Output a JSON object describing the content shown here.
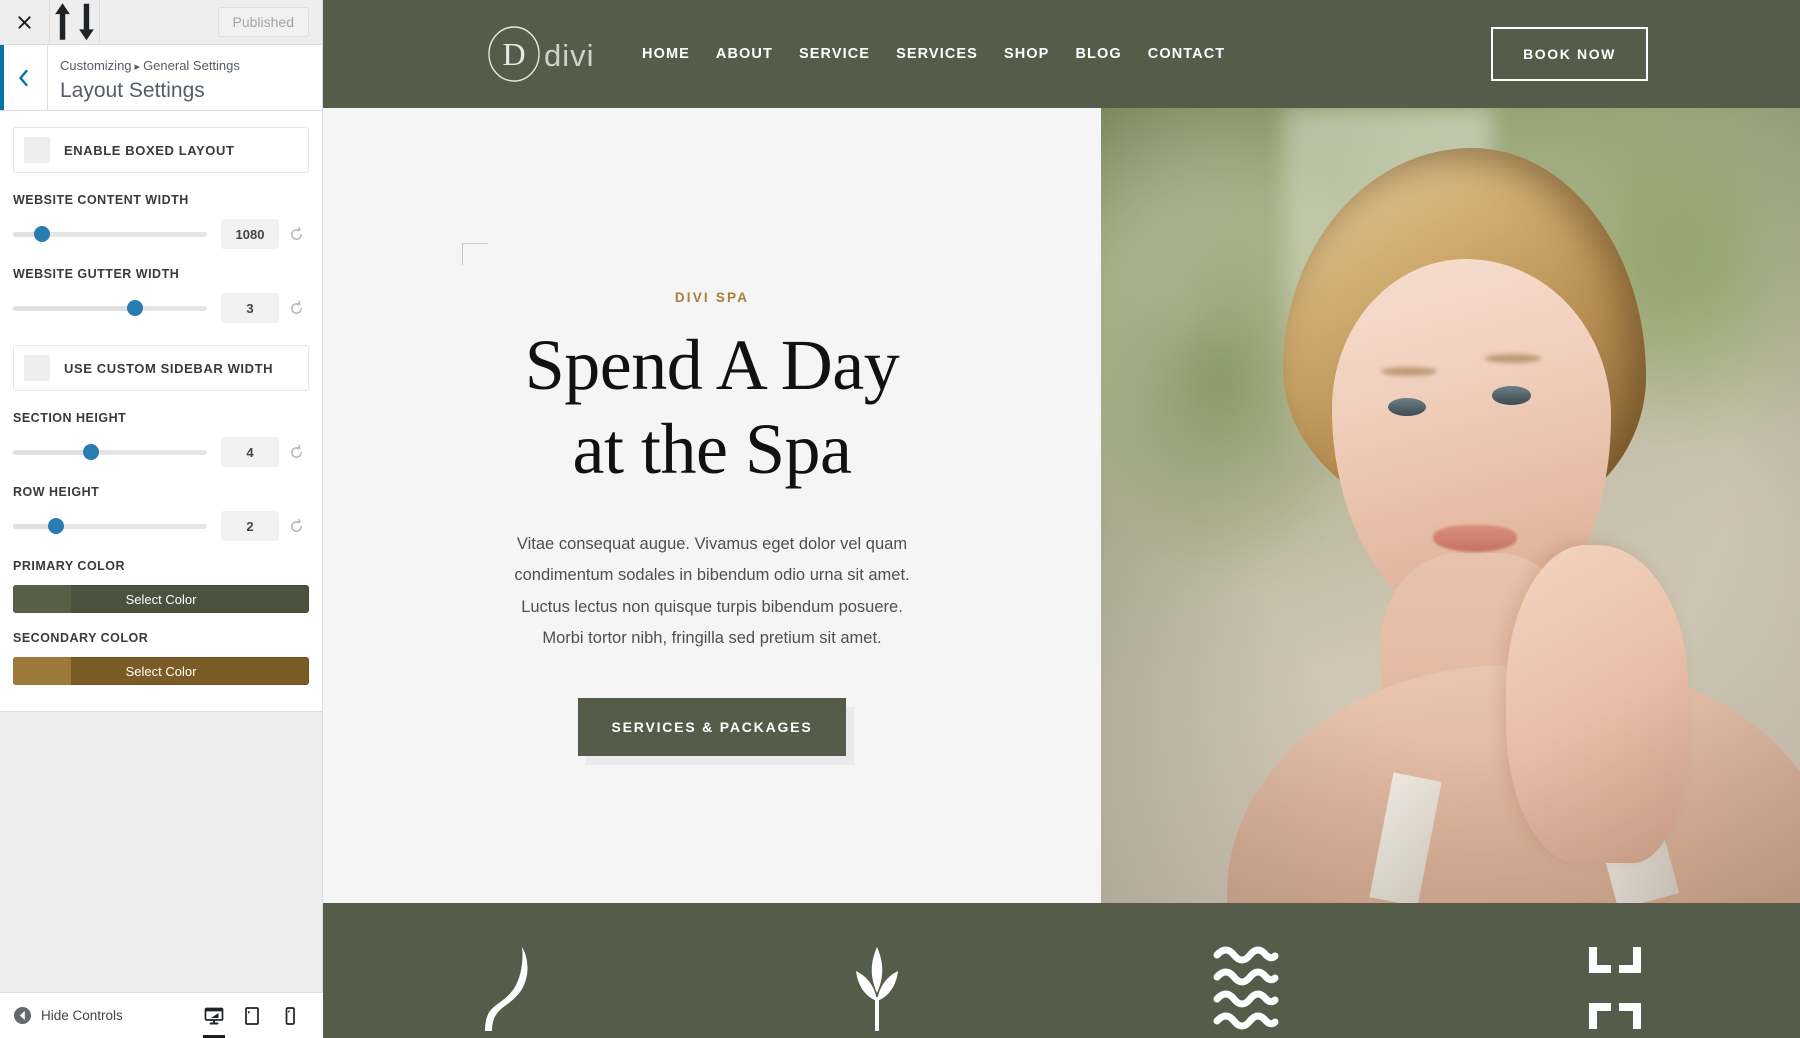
{
  "customizer": {
    "topbar": {
      "close_icon": "close-icon",
      "devices_icon": "sort-arrows-icon",
      "publish_label": "Published"
    },
    "header": {
      "back_icon": "chevron-left-icon",
      "breadcrumb_root": "Customizing",
      "breadcrumb_separator": "▸",
      "breadcrumb_parent": "General Settings",
      "title": "Layout Settings"
    },
    "controls": [
      {
        "type": "toggle",
        "name": "enable-boxed-layout",
        "label": "ENABLE BOXED LAYOUT",
        "checked": false
      },
      {
        "type": "slider",
        "name": "website-content-width",
        "label": "WEBSITE CONTENT WIDTH",
        "value": "1080",
        "percent": 15
      },
      {
        "type": "slider",
        "name": "website-gutter-width",
        "label": "WEBSITE GUTTER WIDTH",
        "value": "3",
        "percent": 63
      },
      {
        "type": "toggle",
        "name": "use-custom-sidebar-width",
        "label": "USE CUSTOM SIDEBAR WIDTH",
        "checked": false
      },
      {
        "type": "slider",
        "name": "section-height",
        "label": "SECTION HEIGHT",
        "value": "4",
        "percent": 40
      },
      {
        "type": "slider",
        "name": "row-height",
        "label": "ROW HEIGHT",
        "value": "2",
        "percent": 22
      },
      {
        "type": "color",
        "name": "primary-color",
        "label": "PRIMARY COLOR",
        "button_label": "Select Color",
        "color": "#4b5340",
        "swatch": "#5b6149"
      },
      {
        "type": "color",
        "name": "secondary-color",
        "label": "SECONDARY COLOR",
        "button_label": "Select Color",
        "color": "#7c5c26",
        "swatch": "#a5813c"
      }
    ],
    "footer": {
      "hide_controls_label": "Hide Controls",
      "hide_controls_icon": "collapse-left-icon",
      "devices": [
        {
          "name": "desktop",
          "icon": "desktop-icon",
          "active": true
        },
        {
          "name": "tablet",
          "icon": "tablet-icon",
          "active": false
        },
        {
          "name": "mobile",
          "icon": "mobile-icon",
          "active": false
        }
      ]
    }
  },
  "site": {
    "brand": {
      "logo_letter": "D",
      "logo_text": "divi"
    },
    "nav": [
      {
        "label": "HOME"
      },
      {
        "label": "ABOUT"
      },
      {
        "label": "SERVICE"
      },
      {
        "label": "SERVICES"
      },
      {
        "label": "SHOP"
      },
      {
        "label": "BLOG"
      },
      {
        "label": "CONTACT"
      }
    ],
    "book_now_label": "BOOK NOW",
    "hero": {
      "eyebrow": "DIVI SPA",
      "title_line1": "Spend A Day",
      "title_line2": "at the Spa",
      "paragraph": "Vitae consequat augue. Vivamus eget dolor vel quam condimentum sodales in bibendum odio urna sit amet. Luctus lectus non quisque turpis bibendum posuere. Morbi tortor nibh, fringilla sed pretium sit amet.",
      "cta_label": "SERVICES & PACKAGES",
      "photo_alt": "woman-portrait-photo"
    },
    "features": [
      {
        "name": "leaf-icon"
      },
      {
        "name": "lotus-plant-icon"
      },
      {
        "name": "water-waves-icon"
      },
      {
        "name": "expand-crosshair-icon"
      }
    ],
    "colors": {
      "brand_green": "#555c49",
      "accent_gold": "#a5813c",
      "page_bg": "#f5f5f5"
    }
  }
}
